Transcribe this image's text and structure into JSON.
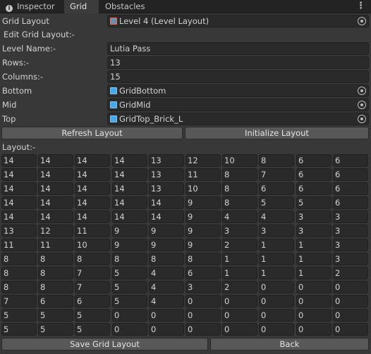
{
  "tabs": [
    {
      "label": "Inspector",
      "icon": "info-icon"
    },
    {
      "label": "Grid"
    },
    {
      "label": "Obstacles"
    }
  ],
  "menu_icon": "kebab-menu-icon",
  "grid_layout": {
    "label": "Grid Layout",
    "value": "Level 4 (Level Layout)"
  },
  "edit_header": "Edit Grid Layout:-",
  "level_name": {
    "label": "Level Name:-",
    "value": "Lutia Pass"
  },
  "rows": {
    "label": "Rows:-",
    "value": "13"
  },
  "columns": {
    "label": "Columns:-",
    "value": "15"
  },
  "bottom": {
    "label": "Bottom",
    "value": "GridBottom"
  },
  "mid": {
    "label": "Mid",
    "value": "GridMid"
  },
  "top": {
    "label": "Top",
    "value": "GridTop_Brick_L"
  },
  "buttons": {
    "refresh": "Refresh Layout",
    "initialize": "Initialize Layout",
    "save": "Save Grid Layout",
    "back": "Back"
  },
  "layout_label": "Layout:-",
  "layout": [
    [
      "14",
      "14",
      "14",
      "14",
      "13",
      "12",
      "10",
      "8",
      "6",
      "6"
    ],
    [
      "14",
      "14",
      "14",
      "14",
      "13",
      "11",
      "8",
      "7",
      "6",
      "6"
    ],
    [
      "14",
      "14",
      "14",
      "14",
      "13",
      "10",
      "8",
      "6",
      "6",
      "6"
    ],
    [
      "14",
      "14",
      "14",
      "14",
      "14",
      "9",
      "8",
      "5",
      "5",
      "6"
    ],
    [
      "14",
      "14",
      "14",
      "14",
      "14",
      "9",
      "4",
      "4",
      "3",
      "3"
    ],
    [
      "13",
      "12",
      "11",
      "9",
      "9",
      "9",
      "3",
      "3",
      "3",
      "3"
    ],
    [
      "11",
      "11",
      "10",
      "9",
      "9",
      "9",
      "2",
      "1",
      "1",
      "3"
    ],
    [
      "8",
      "8",
      "8",
      "8",
      "8",
      "8",
      "1",
      "1",
      "1",
      "3"
    ],
    [
      "8",
      "8",
      "7",
      "5",
      "4",
      "6",
      "1",
      "1",
      "1",
      "2"
    ],
    [
      "8",
      "8",
      "7",
      "5",
      "4",
      "3",
      "2",
      "0",
      "0",
      "0"
    ],
    [
      "7",
      "6",
      "6",
      "5",
      "4",
      "0",
      "0",
      "0",
      "0",
      "0"
    ],
    [
      "5",
      "5",
      "5",
      "0",
      "0",
      "0",
      "0",
      "0",
      "0",
      "0"
    ],
    [
      "5",
      "5",
      "5",
      "0",
      "0",
      "0",
      "0",
      "0",
      "0",
      "0"
    ]
  ],
  "colors": {
    "background": "#383838",
    "field": "#2a2a2a",
    "button": "#585858",
    "tabbar": "#232323"
  }
}
